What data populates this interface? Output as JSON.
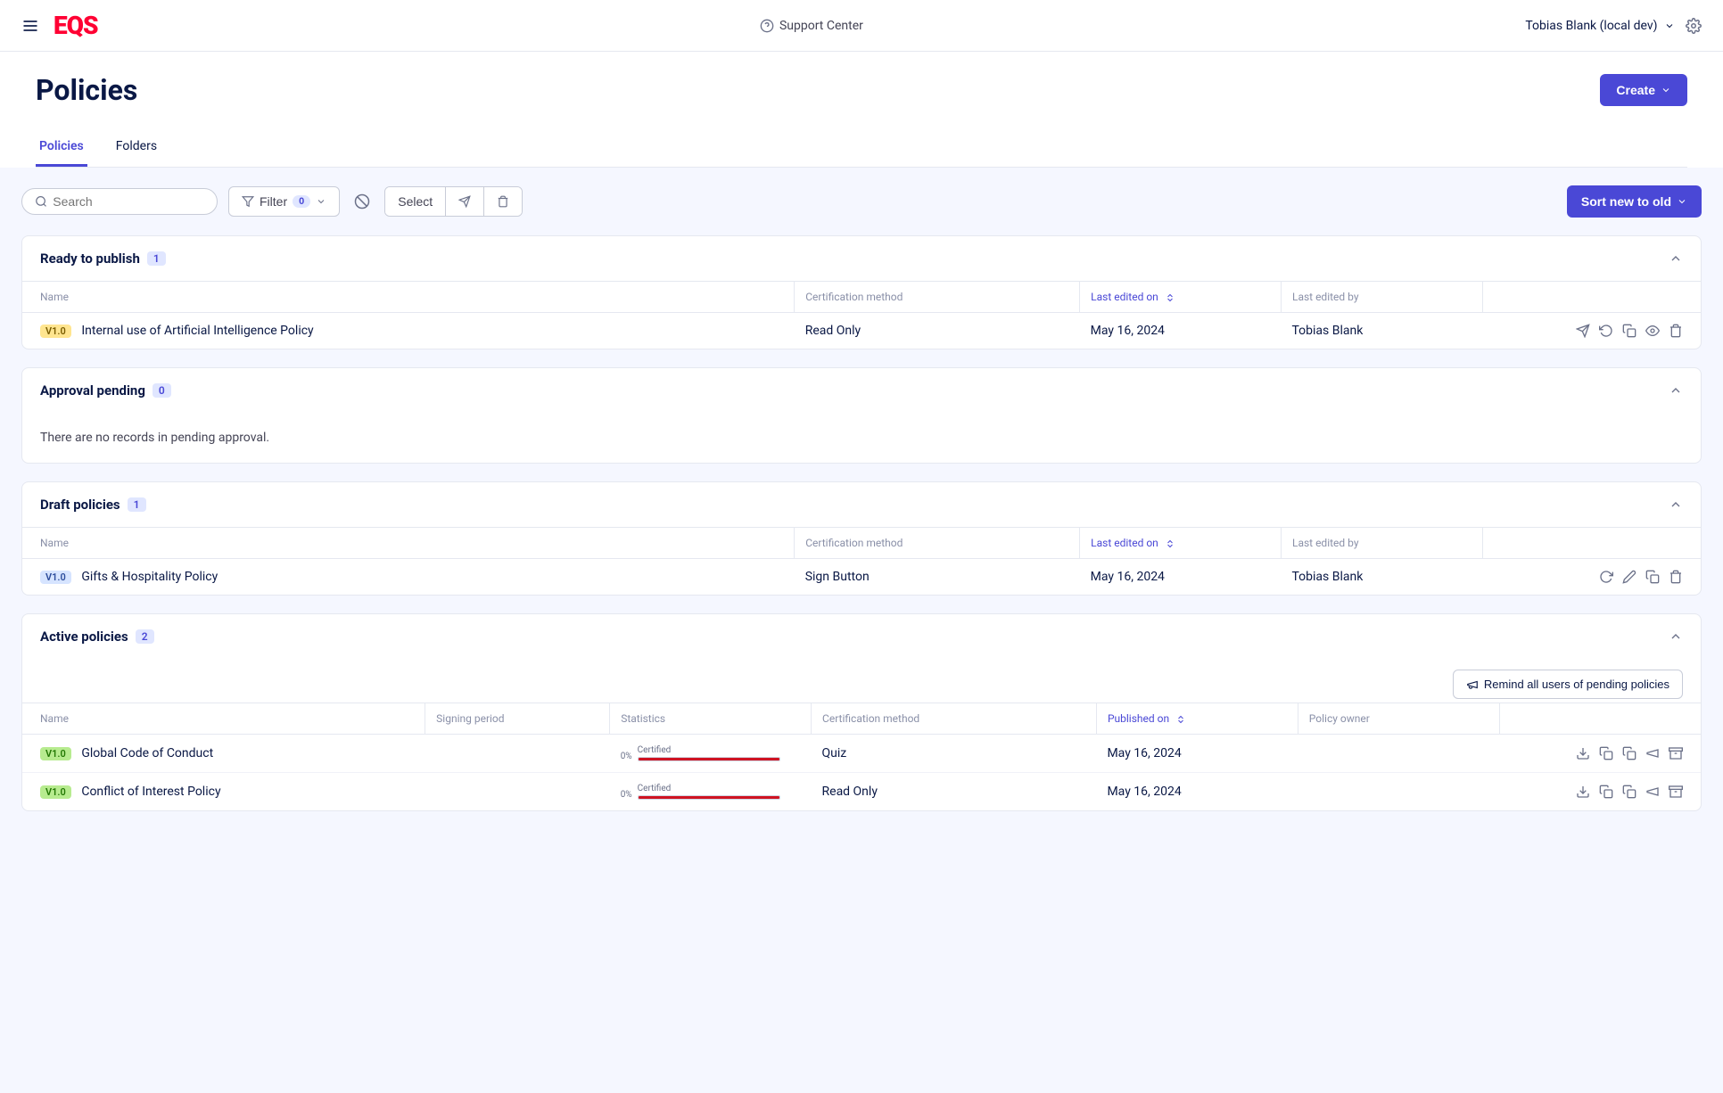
{
  "header": {
    "support_label": "Support Center",
    "user_label": "Tobias Blank (local dev)",
    "logo_text": "EQS"
  },
  "page": {
    "title": "Policies",
    "create_label": "Create"
  },
  "tabs": [
    {
      "label": "Policies",
      "active": true
    },
    {
      "label": "Folders",
      "active": false
    }
  ],
  "toolbar": {
    "search_placeholder": "Search",
    "filter_label": "Filter",
    "filter_count": "0",
    "select_label": "Select",
    "sort_label": "Sort new to old"
  },
  "sections": {
    "ready": {
      "title": "Ready to publish",
      "count": "1",
      "columns": {
        "name": "Name",
        "cert": "Certification method",
        "edited_on": "Last edited on",
        "edited_by": "Last edited by"
      },
      "rows": [
        {
          "version": "V1.0",
          "version_class": "yellow",
          "name": "Internal use of Artificial Intelligence Policy",
          "cert": "Read Only",
          "date": "May 16, 2024",
          "by": "Tobias Blank"
        }
      ]
    },
    "approval": {
      "title": "Approval pending",
      "count": "0",
      "empty": "There are no records in pending approval."
    },
    "draft": {
      "title": "Draft policies",
      "count": "1",
      "columns": {
        "name": "Name",
        "cert": "Certification method",
        "edited_on": "Last edited on",
        "edited_by": "Last edited by"
      },
      "rows": [
        {
          "version": "V1.0",
          "version_class": "blue",
          "name": "Gifts & Hospitality Policy",
          "cert": "Sign Button",
          "date": "May 16, 2024",
          "by": "Tobias Blank"
        }
      ]
    },
    "active": {
      "title": "Active policies",
      "count": "2",
      "remind_label": "Remind all users of pending policies",
      "columns": {
        "name": "Name",
        "signing": "Signing period",
        "stats": "Statistics",
        "cert": "Certification method",
        "published": "Published on",
        "owner": "Policy owner"
      },
      "rows": [
        {
          "version": "V1.0",
          "version_class": "green",
          "name": "Global Code of Conduct",
          "signing": "",
          "stats_label": "Certified",
          "stats_pct": "0%",
          "stats_fill": 100,
          "cert": "Quiz",
          "date": "May 16, 2024",
          "owner": ""
        },
        {
          "version": "V1.0",
          "version_class": "green",
          "name": "Conflict of Interest Policy",
          "signing": "",
          "stats_label": "Certified",
          "stats_pct": "0%",
          "stats_fill": 100,
          "cert": "Read Only",
          "date": "May 16, 2024",
          "owner": ""
        }
      ]
    }
  }
}
